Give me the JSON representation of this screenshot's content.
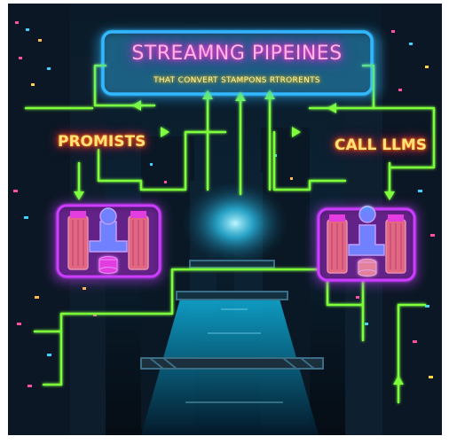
{
  "sign": {
    "title": "STREAMNG PIPEINES",
    "subtitle": "THAT CONVERT STAMPONS RTRORENTS"
  },
  "labels": {
    "left": "PROMISTS",
    "right": "CALL LLMS"
  },
  "colors": {
    "neon_blue": "#2fb8ff",
    "neon_green": "#7dff3a",
    "neon_pink": "#ff3cc8",
    "neon_purple": "#c23cff",
    "neon_orange": "#ff8a1a",
    "water_cyan": "#19d6ff",
    "background": "#06101a"
  },
  "icons": [
    "pipeline-machine-icon",
    "pipeline-machine-icon",
    "database-stack-icon",
    "up-arrow-icon",
    "down-arrow-icon",
    "left-arrow-icon",
    "right-arrow-icon"
  ]
}
